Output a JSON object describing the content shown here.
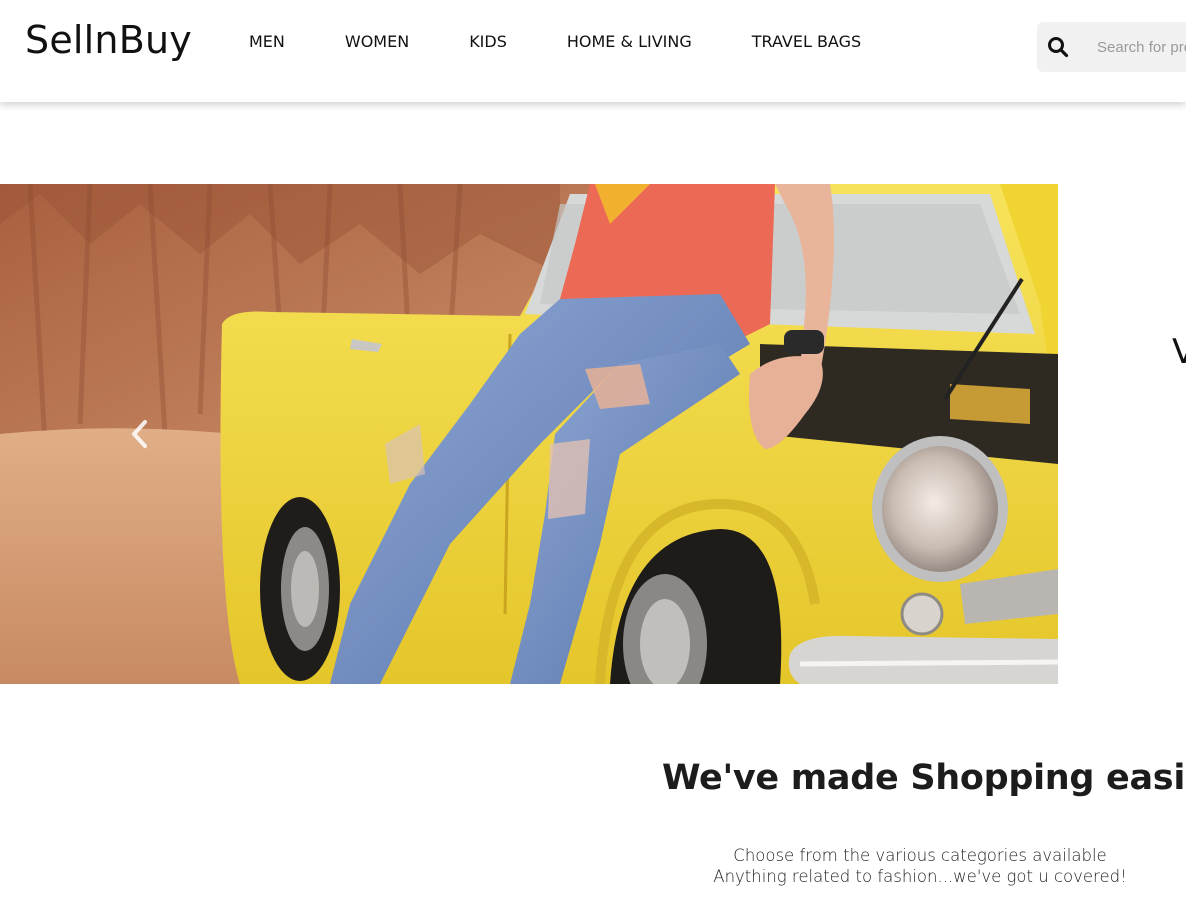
{
  "brand": {
    "name": "SellnBuy"
  },
  "nav": {
    "items": [
      {
        "label": "MEN"
      },
      {
        "label": "WOMEN"
      },
      {
        "label": "KIDS"
      },
      {
        "label": "HOME & LIVING"
      },
      {
        "label": "TRAVEL BAGS"
      }
    ]
  },
  "search": {
    "placeholder": "Search for products, brands and more",
    "icon": "search-icon"
  },
  "carousel": {
    "prev_icon": "chevron-left-icon",
    "slide_image": "man-in-ripped-jeans-on-yellow-vintage-car",
    "next_peek": "V"
  },
  "hero": {
    "title": "We've made Shopping easier",
    "line1": "Choose from the various categories available",
    "line2": "Anything related to fashion...we've got u covered!"
  },
  "colors": {
    "car_yellow": "#f2d93a",
    "shirt_coral": "#ec6a55",
    "jeans_blue": "#6f8fc4",
    "rock_brown": "#b46a43",
    "sand": "#d8a07a",
    "search_bg": "#f1f1f1"
  }
}
